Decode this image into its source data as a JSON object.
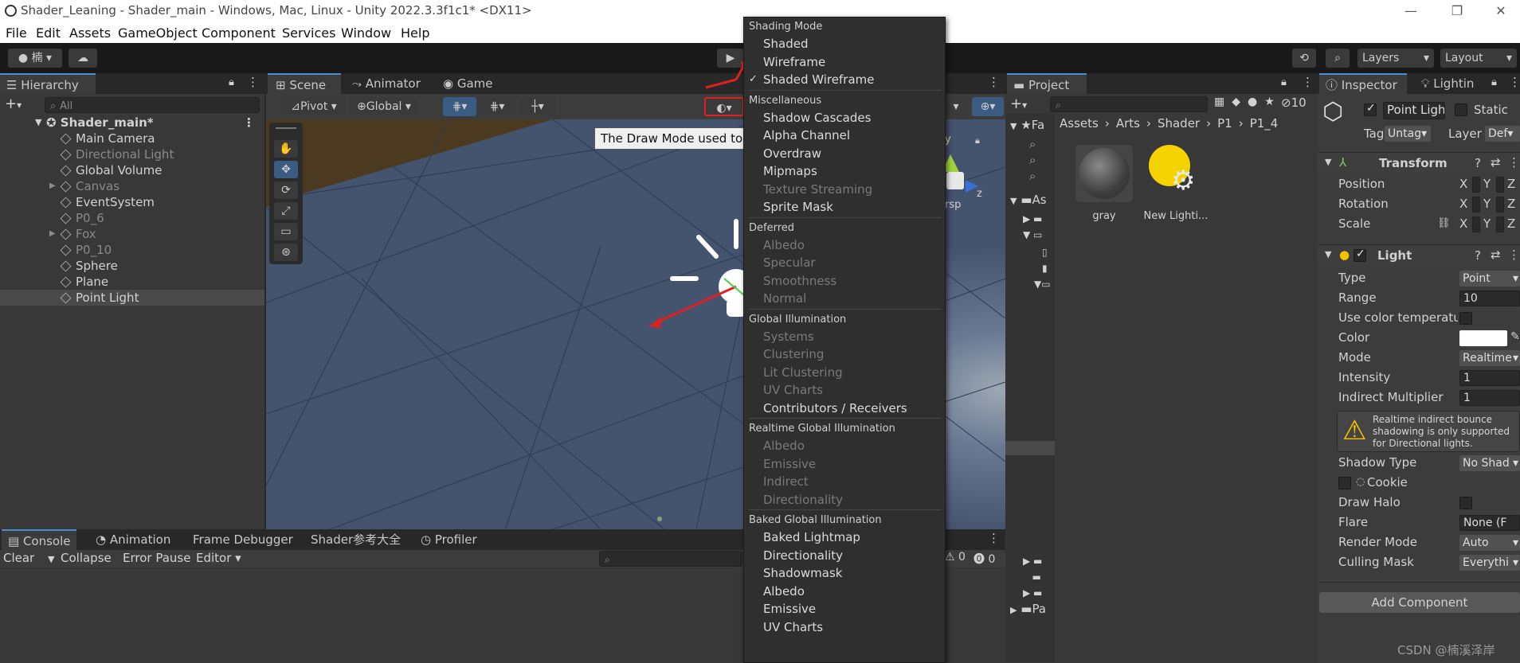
{
  "window": {
    "title": "Shader_Leaning - Shader_main - Windows, Mac, Linux - Unity 2022.3.3f1c1* <DX11>",
    "controls": [
      "—",
      "❐",
      "✕"
    ]
  },
  "menubar": [
    "File",
    "Edit",
    "Assets",
    "GameObject",
    "Component",
    "Services",
    "Window",
    "Help"
  ],
  "toolbar": {
    "account_label": "楠",
    "layers_label": "Layers",
    "layout_label": "Layout"
  },
  "hierarchy": {
    "tab_label": "Hierarchy",
    "search_placeholder": "All",
    "scene_name": "Shader_main*",
    "items": [
      {
        "label": "Main Camera",
        "dim": false
      },
      {
        "label": "Directional Light",
        "dim": true
      },
      {
        "label": "Global Volume",
        "dim": false
      },
      {
        "label": "Canvas",
        "dim": true
      },
      {
        "label": "EventSystem",
        "dim": false
      },
      {
        "label": "P0_6",
        "dim": true
      },
      {
        "label": "Fox",
        "dim": true
      },
      {
        "label": "P0_10",
        "dim": true
      },
      {
        "label": "Sphere",
        "dim": false
      },
      {
        "label": "Plane",
        "dim": false
      },
      {
        "label": "Point Light",
        "dim": false
      }
    ]
  },
  "scene": {
    "tabs": [
      "Scene",
      "Animator",
      "Game"
    ],
    "pivot_label": "Pivot",
    "global_label": "Global",
    "persp_label": "ersp",
    "tooltip": "The Draw Mode used to display the Scene.",
    "axis_y": "y",
    "axis_z": "z"
  },
  "draw_mode_menu": {
    "sections": [
      {
        "header": "Shading Mode",
        "items": [
          {
            "label": "Shaded",
            "disabled": false,
            "checked": false
          },
          {
            "label": "Wireframe",
            "disabled": false,
            "checked": false
          },
          {
            "label": "Shaded Wireframe",
            "disabled": false,
            "checked": true
          }
        ]
      },
      {
        "header": "Miscellaneous",
        "items": [
          {
            "label": "Shadow Cascades",
            "disabled": false
          },
          {
            "label": "Alpha Channel",
            "disabled": false
          },
          {
            "label": "Overdraw",
            "disabled": false
          },
          {
            "label": "Mipmaps",
            "disabled": false
          },
          {
            "label": "Texture Streaming",
            "disabled": true
          },
          {
            "label": "Sprite Mask",
            "disabled": false
          }
        ]
      },
      {
        "header": "Deferred",
        "items": [
          {
            "label": "Albedo",
            "disabled": true
          },
          {
            "label": "Specular",
            "disabled": true
          },
          {
            "label": "Smoothness",
            "disabled": true
          },
          {
            "label": "Normal",
            "disabled": true
          }
        ]
      },
      {
        "header": "Global Illumination",
        "items": [
          {
            "label": "Systems",
            "disabled": true
          },
          {
            "label": "Clustering",
            "disabled": true
          },
          {
            "label": "Lit Clustering",
            "disabled": true
          },
          {
            "label": "UV Charts",
            "disabled": true
          },
          {
            "label": "Contributors / Receivers",
            "disabled": false
          }
        ]
      },
      {
        "header": "Realtime Global Illumination",
        "items": [
          {
            "label": "Albedo",
            "disabled": true
          },
          {
            "label": "Emissive",
            "disabled": true
          },
          {
            "label": "Indirect",
            "disabled": true
          },
          {
            "label": "Directionality",
            "disabled": true
          }
        ]
      },
      {
        "header": "Baked Global Illumination",
        "items": [
          {
            "label": "Baked Lightmap",
            "disabled": false
          },
          {
            "label": "Directionality",
            "disabled": false
          },
          {
            "label": "Shadowmask",
            "disabled": false
          },
          {
            "label": "Albedo",
            "disabled": false
          },
          {
            "label": "Emissive",
            "disabled": false
          },
          {
            "label": "UV Charts",
            "disabled": false
          }
        ]
      }
    ]
  },
  "project": {
    "tab_label": "Project",
    "breadcrumb": [
      "Assets",
      "Arts",
      "Shader",
      "P1",
      "P1_4"
    ],
    "count_label": "10",
    "tree_labels": [
      "Fa",
      "As",
      "Pa"
    ],
    "assets": [
      {
        "label": "gray"
      },
      {
        "label": "New Lighti..."
      }
    ]
  },
  "console": {
    "tabs": [
      "Console",
      "Animation",
      "Frame Debugger",
      "Shader参考大全",
      "Profiler"
    ],
    "buttons": [
      "Clear",
      "Collapse",
      "Error Pause",
      "Editor"
    ],
    "warn_count": "0",
    "error_count": "0"
  },
  "inspector": {
    "tabs": [
      "Inspector",
      "Lightin"
    ],
    "object_name": "Point Ligh",
    "static_label": "Static",
    "tag_label": "Tag",
    "tag_value": "Untag",
    "layer_label": "Layer",
    "layer_value": "Def",
    "transform": {
      "title": "Transform",
      "rows": [
        "Position",
        "Rotation",
        "Scale"
      ],
      "axes": [
        "X",
        "Y",
        "Z"
      ]
    },
    "light": {
      "title": "Light",
      "fields": [
        {
          "label": "Type",
          "value": "Point",
          "kind": "drop"
        },
        {
          "label": "Range",
          "value": "10",
          "kind": "field"
        },
        {
          "label": "Use color temperatur",
          "value": "",
          "kind": "check"
        },
        {
          "label": "Color",
          "value": "",
          "kind": "color"
        },
        {
          "label": "Mode",
          "value": "Realtime",
          "kind": "drop"
        },
        {
          "label": "Intensity",
          "value": "1",
          "kind": "field"
        },
        {
          "label": "Indirect Multiplier",
          "value": "1",
          "kind": "field"
        }
      ],
      "warning": "Realtime indirect bounce shadowing is only supported for Directional lights.",
      "fields2": [
        {
          "label": "Shadow Type",
          "value": "No Shad",
          "kind": "drop"
        },
        {
          "label": "Cookie",
          "value": "",
          "kind": "none"
        },
        {
          "label": "Draw Halo",
          "value": "",
          "kind": "check"
        },
        {
          "label": "Flare",
          "value": "None (F",
          "kind": "field"
        },
        {
          "label": "Render Mode",
          "value": "Auto",
          "kind": "drop"
        },
        {
          "label": "Culling Mask",
          "value": "Everythi",
          "kind": "drop"
        }
      ]
    },
    "add_component_label": "Add Component"
  },
  "watermark": "CSDN @楠溪泽岸",
  "colors": {
    "accent": "#4a8cd4",
    "annotation_red": "#e02020",
    "panel_bg": "#383838",
    "menu_bg": "#2f2f2f",
    "warning": "#f5c400"
  }
}
